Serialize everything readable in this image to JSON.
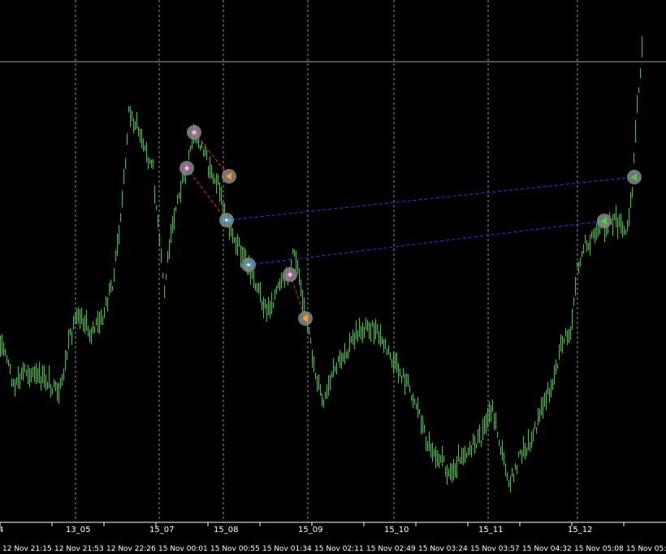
{
  "chart": {
    "background": "#000000",
    "bar_color": "#32CD32",
    "grid_color": "#c0c0c0",
    "price_line_color": "#8fa3bf",
    "deal_line_buy_color": "#1e3cff",
    "deal_line_sell_color": "#ff2020",
    "axis_color": "#ffffff"
  },
  "period_separators": [
    {
      "label": "13_05"
    },
    {
      "label": "15_07"
    },
    {
      "label": "15_08"
    },
    {
      "label": "15_09"
    },
    {
      "label": "15_10"
    },
    {
      "label": "15_11"
    },
    {
      "label": "15_12"
    }
  ],
  "left_edge_label": "4",
  "time_axis": [
    "12 Nov 21:15",
    "12 Nov 21:53",
    "12 Nov 22:26",
    "15 Nov 00:01",
    "15 Nov 00:55",
    "15 Nov 01:34",
    "15 Nov 02:11",
    "15 Nov 02:49",
    "15 Nov 03:24",
    "15 Nov 03:57",
    "15 Nov 04:32",
    "15 Nov 05:08",
    "15 Nov 05:4"
  ],
  "trade_markers": [
    {
      "type": "sell-entry",
      "icon": "pink-diamond-arrow"
    },
    {
      "type": "sell-entry",
      "icon": "pink-diamond-arrow"
    },
    {
      "type": "sell-exit",
      "icon": "orange-triangle"
    },
    {
      "type": "buy-entry",
      "icon": "blue-cross-arrow"
    },
    {
      "type": "buy-entry",
      "icon": "blue-cross-arrow"
    },
    {
      "type": "sell-entry",
      "icon": "pink-diamond-arrow"
    },
    {
      "type": "sell-exit",
      "icon": "orange-triangle"
    },
    {
      "type": "buy-exit",
      "icon": "green-triangle"
    },
    {
      "type": "buy-exit",
      "icon": "green-triangle"
    }
  ]
}
